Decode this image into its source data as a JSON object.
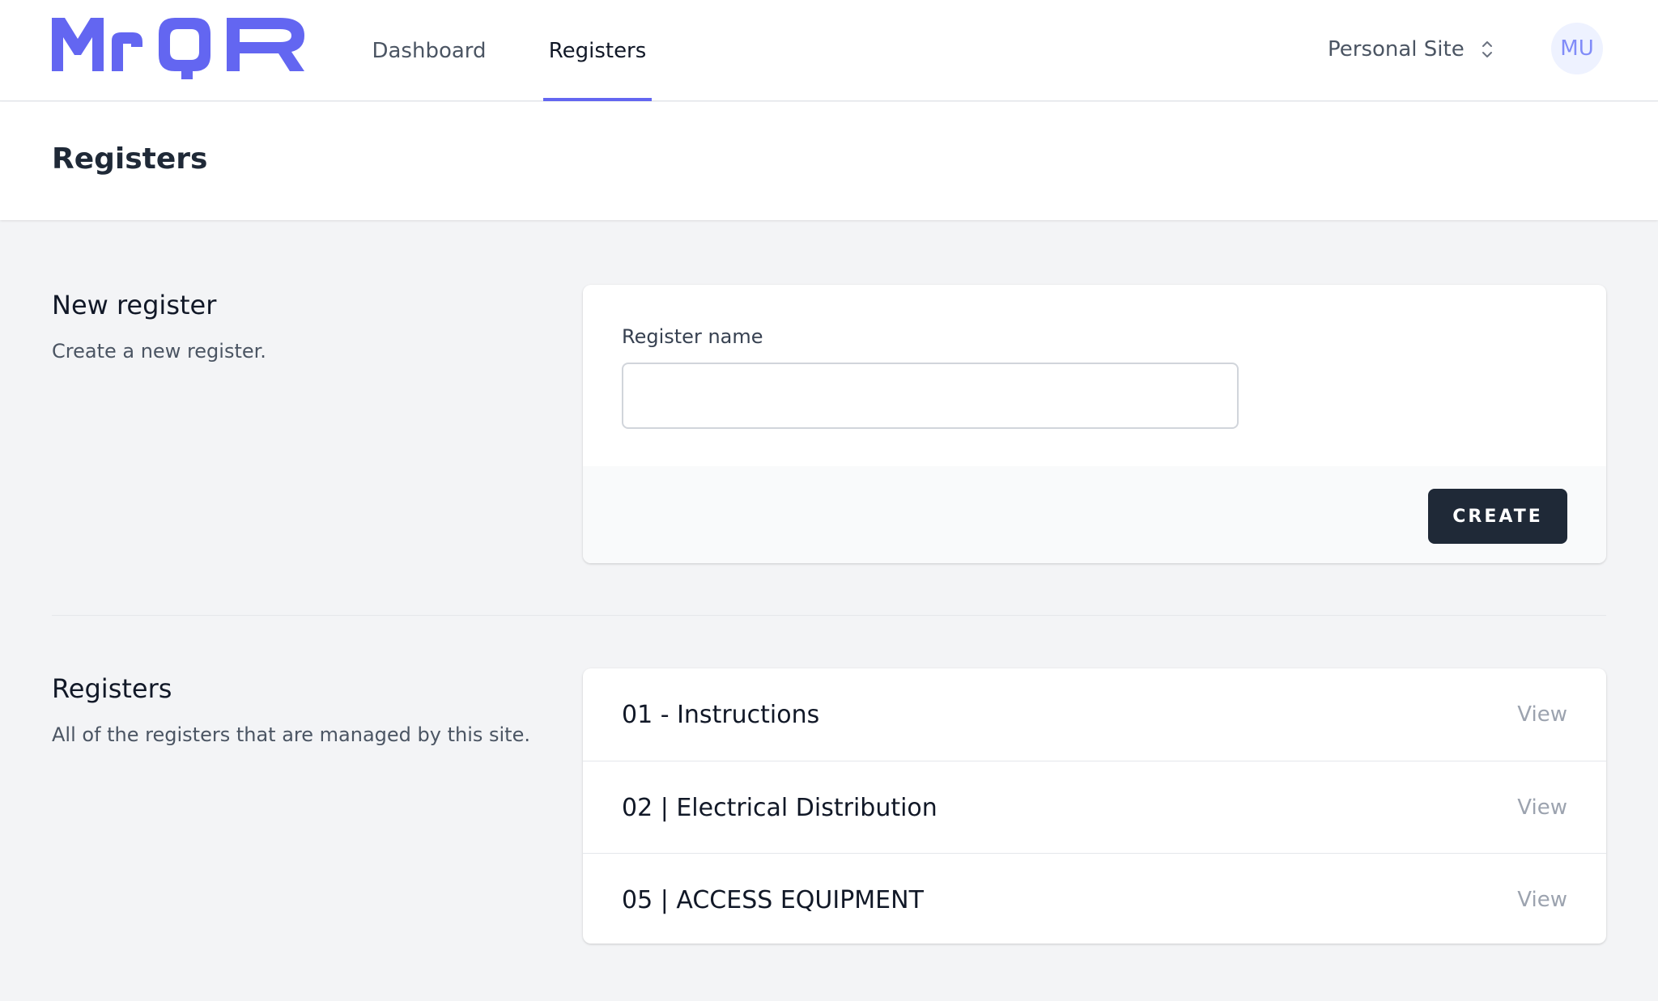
{
  "brand": {
    "logo_text": "MrQR",
    "accent": "#6366f1"
  },
  "nav": {
    "tabs": [
      {
        "label": "Dashboard",
        "active": false
      },
      {
        "label": "Registers",
        "active": true
      }
    ],
    "site_switcher": {
      "label": "Personal Site",
      "icon": "chevron-up-down-icon"
    },
    "avatar_initials": "MU"
  },
  "page": {
    "title": "Registers"
  },
  "new_register": {
    "heading": "New register",
    "description": "Create a new register.",
    "field_label": "Register name",
    "field_value": "",
    "create_label": "CREATE"
  },
  "registers": {
    "heading": "Registers",
    "description": "All of the registers that are managed by this site.",
    "items": [
      {
        "name": "01 - Instructions",
        "action": "View"
      },
      {
        "name": "02 | Electrical Distribution",
        "action": "View"
      },
      {
        "name": "05 | ACCESS EQUIPMENT",
        "action": "View"
      }
    ]
  }
}
